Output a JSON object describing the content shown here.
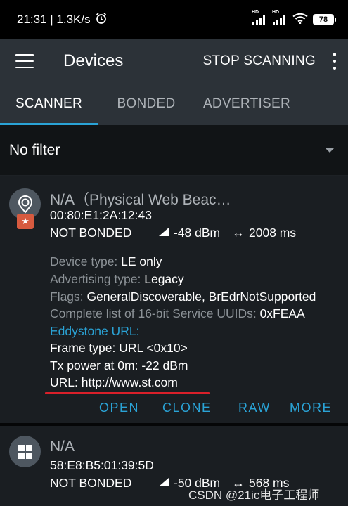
{
  "status_bar": {
    "time_speed": "21:31 | 1.3K/s",
    "network_hd1": "HD",
    "network_hd2": "HD",
    "battery": "78"
  },
  "app_bar": {
    "title": "Devices",
    "stop_scanning": "STOP SCANNING"
  },
  "tabs": [
    {
      "label": "SCANNER",
      "active": true
    },
    {
      "label": "BONDED",
      "active": false
    },
    {
      "label": "ADVERTISER",
      "active": false
    }
  ],
  "filter": {
    "label": "No filter"
  },
  "devices": [
    {
      "name": "N/A（Physical Web Beac…",
      "address": "00:80:E1:2A:12:43",
      "bond_state": "NOT BONDED",
      "rssi": "-48 dBm",
      "interval": "2008 ms",
      "details": {
        "device_type_label": "Device type: ",
        "device_type_value": "LE only",
        "adv_type_label": "Advertising type: ",
        "adv_type_value": "Legacy",
        "flags_label": "Flags: ",
        "flags_value": "GeneralDiscoverable, BrEdrNotSupported",
        "uuids_label": "Complete list of 16-bit Service UUIDs: ",
        "uuids_value": "0xFEAA",
        "eddystone_label": "Eddystone URL:",
        "frame_type": "Frame type: URL <0x10>",
        "tx_power": "Tx power at 0m: -22 dBm",
        "url": "URL: http://www.st.com"
      },
      "actions": [
        "OPEN",
        "CLONE",
        "RAW",
        "MORE"
      ]
    },
    {
      "name": "N/A",
      "address": "58:E8:B5:01:39:5D",
      "bond_state": "NOT BONDED",
      "rssi": "-50 dBm",
      "interval": "568 ms"
    }
  ],
  "watermark": "CSDN @21ic电子工程师",
  "colors": {
    "accent": "#2aa3d6",
    "app_bar": "#2c3238",
    "card": "#1a1e22",
    "underline": "#d9202a",
    "badge": "#d75a3f"
  }
}
